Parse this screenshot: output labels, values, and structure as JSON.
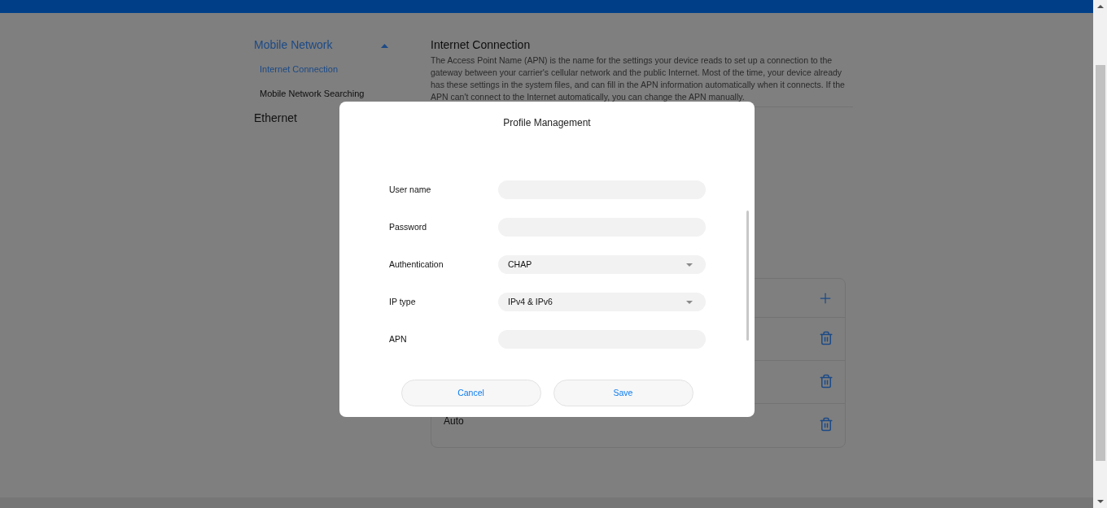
{
  "sidebar": {
    "sections": [
      {
        "label": "Mobile Network",
        "expanded": true,
        "selected": true,
        "children": [
          {
            "label": "Internet Connection",
            "selected": true
          },
          {
            "label": "Mobile Network Searching",
            "selected": false
          }
        ]
      },
      {
        "label": "Ethernet",
        "selected": false
      }
    ]
  },
  "content": {
    "title": "Internet Connection",
    "description": "The Access Point Name (APN) is the name for the settings your device reads to set up a connection to the gateway between your carrier's cellular network and the public Internet. Most of the time, your device already has these settings in the system files, and can fill in the APN information automatically when it connects. If the APN can't connect to the Internet automatically, you can change the APN manually.",
    "profiles": [
      {
        "kind": "add"
      },
      {
        "kind": "item"
      },
      {
        "kind": "item"
      },
      {
        "kind": "item",
        "name": "Auto"
      }
    ]
  },
  "dialog": {
    "title": "Profile Management",
    "fields": [
      {
        "label": "User name",
        "kind": "text"
      },
      {
        "label": "Password",
        "kind": "text"
      },
      {
        "label": "Authentication",
        "kind": "select",
        "value": "CHAP"
      },
      {
        "label": "IP type",
        "kind": "select",
        "value": "IPv4 & IPv6"
      },
      {
        "label": "APN",
        "kind": "text"
      }
    ],
    "buttons": [
      "Cancel",
      "Save"
    ]
  }
}
